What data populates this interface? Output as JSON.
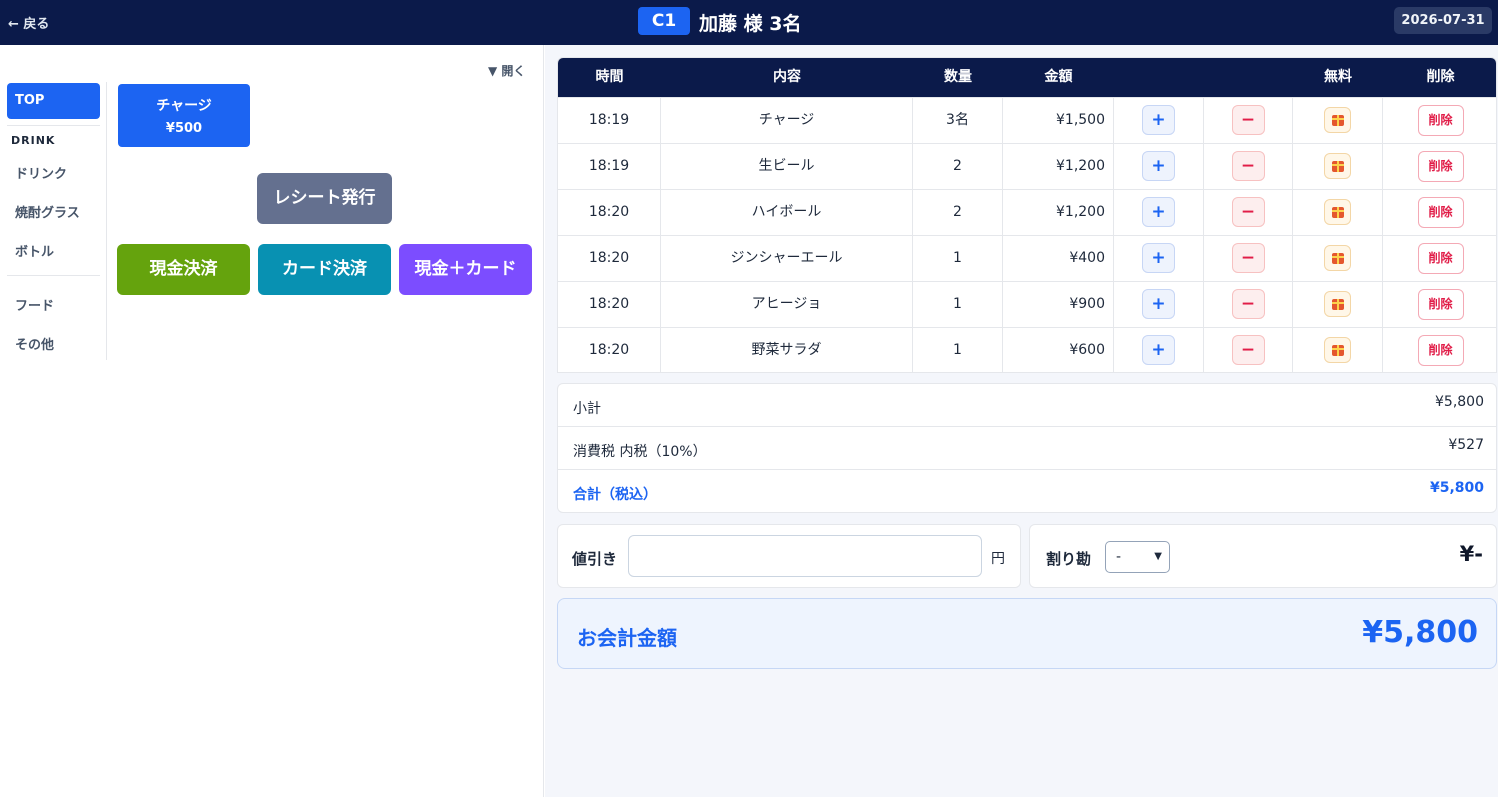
{
  "header": {
    "back_label": "← 戻る",
    "table_id": "C1",
    "guest_label": "加藤 様 3名",
    "date": "2026-07-31"
  },
  "menu": {
    "toggle_label": "▼ 開く",
    "categories": {
      "top": "TOP",
      "drink_heading": "DRINK",
      "drink": "ドリンク",
      "shochu": "焼酎グラス",
      "bottle": "ボトル",
      "food": "フード",
      "other": "その他"
    },
    "charge": {
      "name": "チャージ",
      "price": "¥500"
    },
    "receipt_label": "レシート発行",
    "pay_cash": "現金決済",
    "pay_card": "カード決済",
    "pay_mixed": "現金＋カード"
  },
  "order": {
    "headers": {
      "time": "時間",
      "item": "内容",
      "qty": "数量",
      "amount": "金額",
      "free": "無料",
      "delete": "削除"
    },
    "plus_label": "+",
    "minus_label": "−",
    "delete_label": "削除",
    "rows": [
      {
        "time": "18:19",
        "item": "チャージ",
        "qty": "3名",
        "amount": "¥1,500"
      },
      {
        "time": "18:19",
        "item": "生ビール",
        "qty": "2",
        "amount": "¥1,200"
      },
      {
        "time": "18:20",
        "item": "ハイボール",
        "qty": "2",
        "amount": "¥1,200"
      },
      {
        "time": "18:20",
        "item": "ジンシャーエール",
        "qty": "1",
        "amount": "¥400"
      },
      {
        "time": "18:20",
        "item": "アヒージョ",
        "qty": "1",
        "amount": "¥900"
      },
      {
        "time": "18:20",
        "item": "野菜サラダ",
        "qty": "1",
        "amount": "¥600"
      }
    ]
  },
  "summary": {
    "subtotal_label": "小計",
    "subtotal": "¥5,800",
    "tax_label": "消費税 内税（10%）",
    "tax": "¥527",
    "total_label": "合計（税込）",
    "total": "¥5,800"
  },
  "discount": {
    "label": "値引き",
    "value": "",
    "unit": "円"
  },
  "split": {
    "label": "割り勘",
    "selected": "-",
    "value": "¥-"
  },
  "grand": {
    "label": "お会計金額",
    "value": "¥5,800"
  },
  "colors": {
    "navy": "#0b1a4a",
    "primary": "#1c64f2",
    "cash": "#65a30d",
    "card": "#0891b2",
    "mixed": "#7c4dff",
    "receipt": "#64708f"
  }
}
